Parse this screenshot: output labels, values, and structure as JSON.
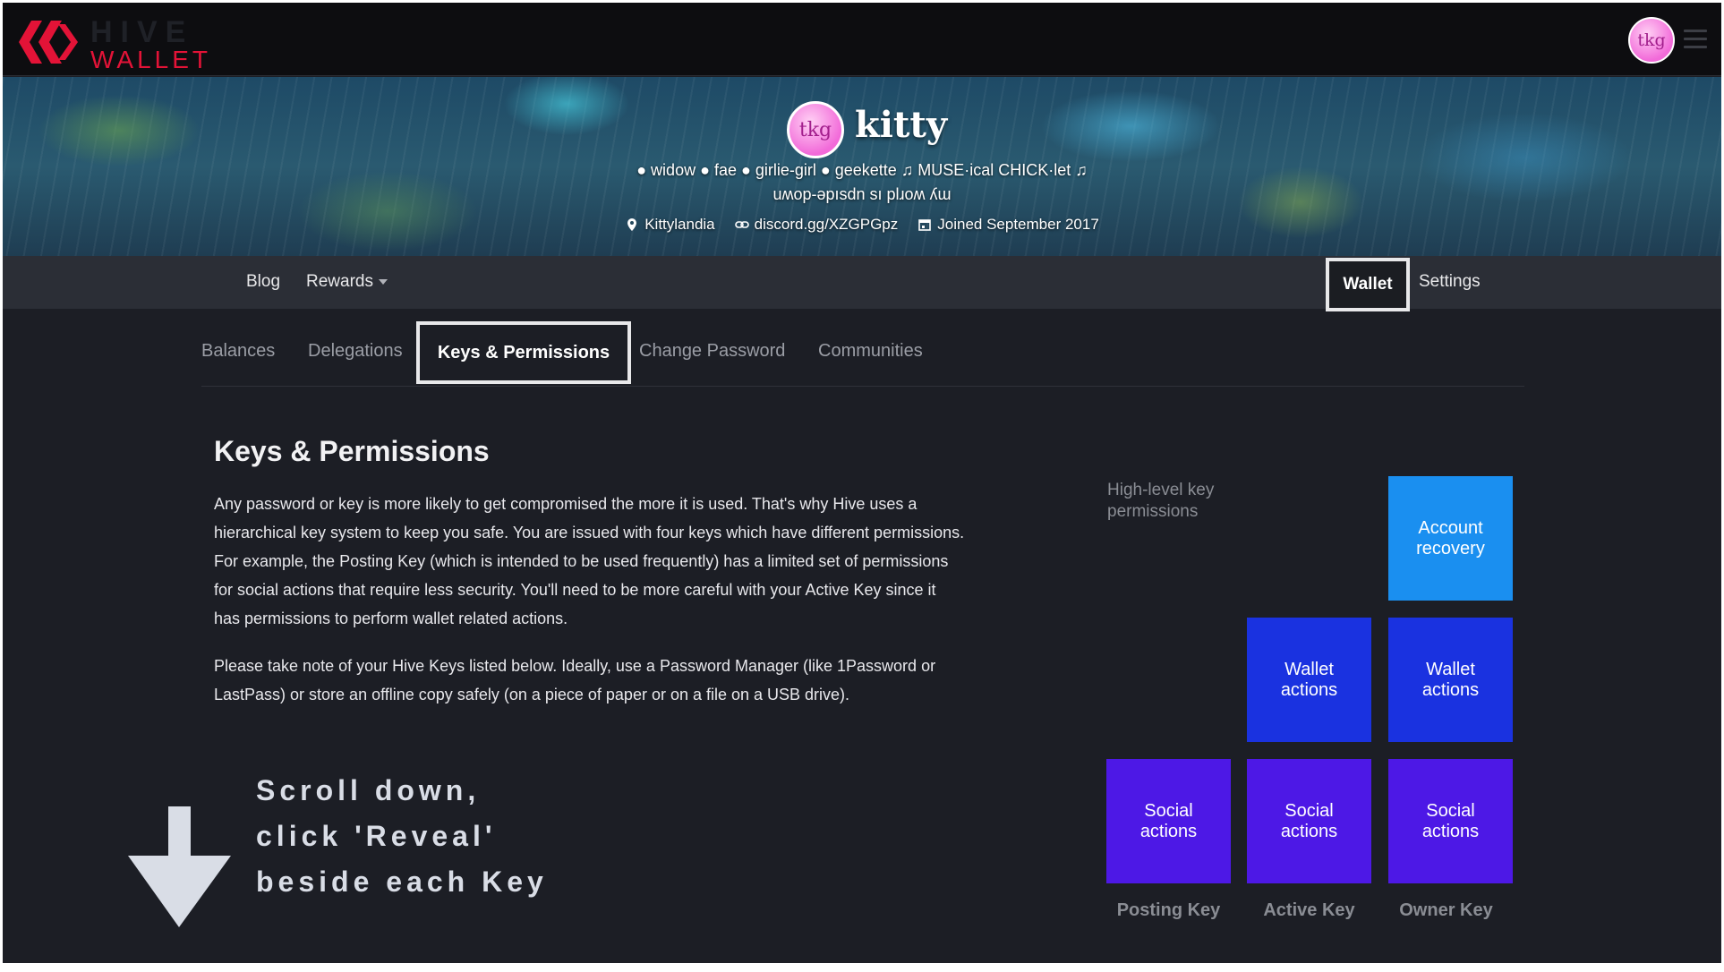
{
  "brand": {
    "logo_top": "HIVE",
    "logo_bottom": "WALLET",
    "accent_color": "#e31337"
  },
  "header": {
    "avatar_text": "tkg",
    "menu_icon": "hamburger-menu-icon"
  },
  "profile": {
    "avatar_text": "tkg",
    "name": "kitty",
    "about_line1": "● widow ● fae ● girlie-girl ● geekette ♫ MUSE·ical CHICK·let ♫",
    "about_line2": "uʍop-ǝpısdn sı plɹoʍ ʎɯ",
    "location": "Kittylandia",
    "website": "discord.gg/XZGPGpz",
    "joined": "Joined September 2017"
  },
  "nav": {
    "blog": "Blog",
    "rewards": "Rewards",
    "wallet": "Wallet",
    "settings": "Settings"
  },
  "tabs": {
    "balances": "Balances",
    "delegations": "Delegations",
    "keys": "Keys & Permissions",
    "change_password": "Change Password",
    "communities": "Communities"
  },
  "content": {
    "title": "Keys & Permissions",
    "para1": "Any password or key is more likely to get compromised the more it is used. That's why Hive uses a hierarchical key system to keep you safe. You are issued with four keys which have different permissions. For example, the Posting Key (which is intended to be used frequently) has a limited set of permissions for social actions that require less security. You'll need to be more careful with your Active Key since it has permissions to perform wallet related actions.",
    "para2": "Please take note of your Hive Keys listed below. Ideally, use a Password Manager (like 1Password or LastPass) or store an offline copy safely (on a piece of paper or on a file on a USB drive)."
  },
  "annotation": {
    "line1": "Scroll down,",
    "line2": "click 'Reveal'",
    "line3": "beside each Key"
  },
  "diagram": {
    "label": "High-level key permissions",
    "boxes": {
      "account_recovery": "Account recovery",
      "wallet_actions": "Wallet actions",
      "social_actions": "Social actions"
    },
    "captions": {
      "posting": "Posting Key",
      "active": "Active Key",
      "owner": "Owner Key"
    },
    "colors": {
      "recovery": "#1a8ff0",
      "wallet": "#1a32e0",
      "social": "#4d18e6"
    }
  }
}
